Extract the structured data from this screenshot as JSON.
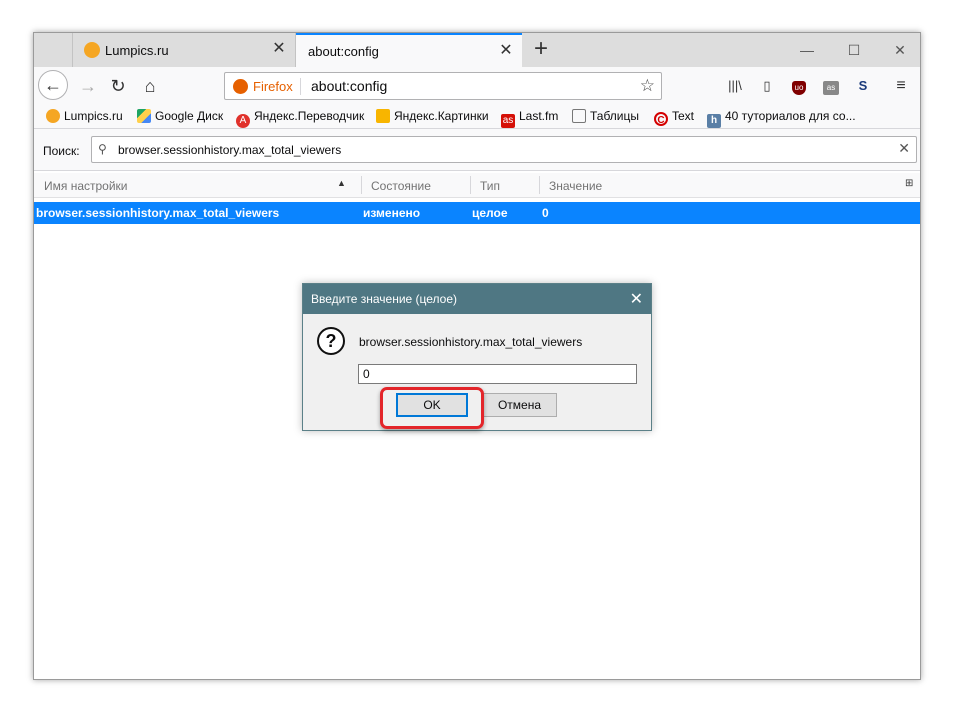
{
  "browser": {
    "tabs": [
      {
        "title": "Lumpics.ru",
        "active": false
      },
      {
        "title": "about:config",
        "active": true
      }
    ],
    "new_tab_icon": "plus-icon",
    "window_controls": [
      "minimize",
      "maximize",
      "close"
    ]
  },
  "navbar": {
    "identity_label": "Firefox",
    "url": "about:config"
  },
  "bookmarks": [
    {
      "label": "Lumpics.ru",
      "icon": "lumpics-icon",
      "color": "#f5a623"
    },
    {
      "label": "Google Диск",
      "icon": "google-drive-icon",
      "color": "#1fa463"
    },
    {
      "label": "Яндекс.Переводчик",
      "icon": "yandex-translate-icon",
      "color": "#e0312b"
    },
    {
      "label": "Яндекс.Картинки",
      "icon": "yandex-images-icon",
      "color": "#f8b500"
    },
    {
      "label": "Last.fm",
      "icon": "lastfm-icon",
      "color": "#d51007"
    },
    {
      "label": "Таблицы",
      "icon": "folder-icon",
      "color": "#777777"
    },
    {
      "label": "Text",
      "icon": "copyright-icon",
      "color": "#d40000"
    },
    {
      "label": "40 туториалов для со...",
      "icon": "h-icon",
      "color": "#5a7fa6"
    }
  ],
  "search": {
    "label": "Поиск:",
    "value": "browser.sessionhistory.max_total_viewers"
  },
  "table": {
    "columns": [
      "Имя настройки",
      "Состояние",
      "Тип",
      "Значение"
    ],
    "rows": [
      {
        "name": "browser.sessionhistory.max_total_viewers",
        "state": "изменено",
        "type": "целое",
        "value": "0"
      }
    ]
  },
  "dialog": {
    "title": "Введите значение (целое)",
    "message": "browser.sessionhistory.max_total_viewers",
    "input_value": "0",
    "ok_label": "OK",
    "cancel_label": "Отмена"
  },
  "colors": {
    "accent": "#0a84ff",
    "dialog_title": "#4f7783",
    "highlight": "#e3262b"
  }
}
